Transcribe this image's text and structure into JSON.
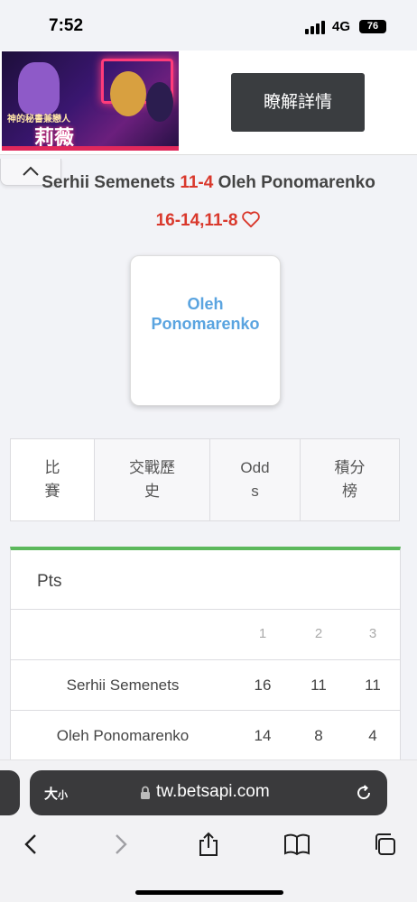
{
  "status_bar": {
    "time": "7:52",
    "network": "4G",
    "battery": "76"
  },
  "ad": {
    "character_subtitle": "神的秘書兼戀人",
    "character_name": "莉薇",
    "button_label": "瞭解詳情"
  },
  "match": {
    "player1": "Serhii Semenets",
    "score": "11-4",
    "player2": "Oleh Ponomarenko",
    "sets": "16-14,11-8",
    "card_player": "Oleh Ponomarenko"
  },
  "tabs": [
    {
      "label": "比賽"
    },
    {
      "label": "交戰歷史"
    },
    {
      "label": "Odds"
    },
    {
      "label": "積分榜"
    }
  ],
  "score_table": {
    "heading": "Pts",
    "columns": [
      "1",
      "2",
      "3"
    ],
    "rows": [
      {
        "name": "Serhii Semenets",
        "scores": [
          "16",
          "11",
          "11"
        ]
      },
      {
        "name": "Oleh Ponomarenko",
        "scores": [
          "14",
          "8",
          "4"
        ]
      }
    ]
  },
  "browser": {
    "text_size_label": "大",
    "text_size_small": "小",
    "url": "tw.betsapi.com"
  },
  "colors": {
    "accent_red": "#d9382c",
    "link_blue": "#5aa4e0",
    "panel_green": "#5cb85c"
  }
}
